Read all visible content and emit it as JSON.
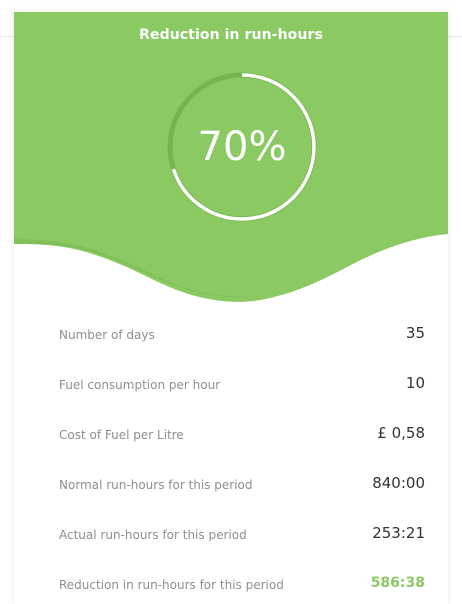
{
  "colors": {
    "accent": "#8bc963",
    "accent_dark": "#7ab653",
    "ring_track": "#77b44f",
    "ring_progress": "#ffffff",
    "label_text": "#8f8f8f",
    "value_text": "#333333"
  },
  "header": {
    "title": "Reduction in run-hours",
    "percent": 0.7,
    "percent_label": "70%"
  },
  "rows": [
    {
      "label": "Number of days",
      "value": "35",
      "highlight": false
    },
    {
      "label": "Fuel consumption per hour",
      "value": "10",
      "highlight": false
    },
    {
      "label": "Cost of Fuel per Litre",
      "value": "£ 0,58",
      "highlight": false
    },
    {
      "label": "Normal run-hours for this period",
      "value": "840:00",
      "highlight": false
    },
    {
      "label": "Actual run-hours for this period",
      "value": "253:21",
      "highlight": false
    },
    {
      "label": "Reduction in run-hours for this period",
      "value": "586:38",
      "highlight": true
    }
  ]
}
